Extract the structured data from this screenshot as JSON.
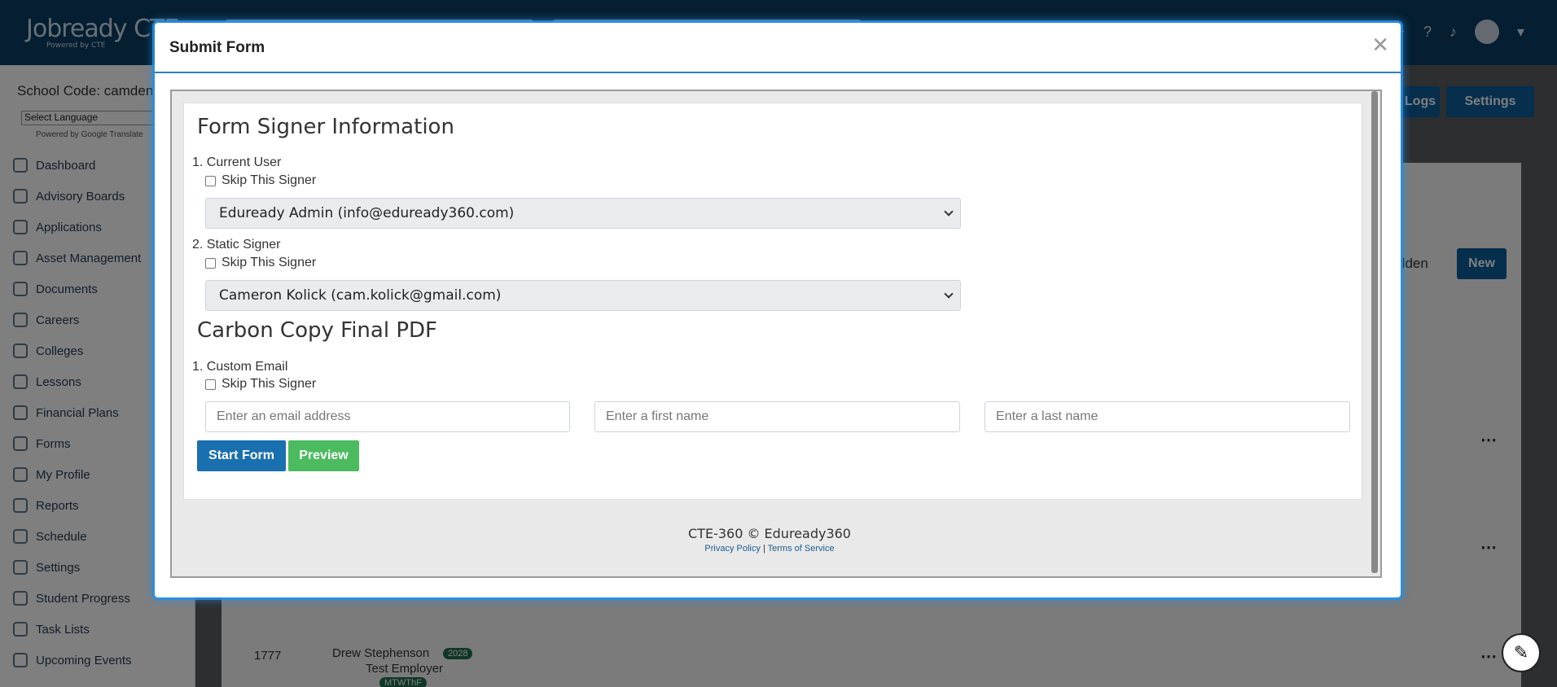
{
  "background": {
    "logo": "Jobready CTE",
    "logo_sub": "Powered by CTE",
    "school_code": "School Code: camden",
    "language_select": "Select Language",
    "powered_by": "Powered by Google Translate",
    "nav": [
      {
        "label": "Dashboard",
        "icon": "gauge-icon"
      },
      {
        "label": "Advisory Boards",
        "icon": "handshake-icon"
      },
      {
        "label": "Applications",
        "icon": "file-icon"
      },
      {
        "label": "Asset Management",
        "icon": "box-icon"
      },
      {
        "label": "Documents",
        "icon": "document-icon"
      },
      {
        "label": "Careers",
        "icon": "person-icon"
      },
      {
        "label": "Colleges",
        "icon": "graduation-cap-icon"
      },
      {
        "label": "Lessons",
        "icon": "board-icon"
      },
      {
        "label": "Financial Plans",
        "icon": "piggy-bank-icon"
      },
      {
        "label": "Forms",
        "icon": "form-icon"
      },
      {
        "label": "My Profile",
        "icon": "user-icon"
      },
      {
        "label": "Reports",
        "icon": "printer-icon"
      },
      {
        "label": "Schedule",
        "icon": "clock-icon"
      },
      {
        "label": "Settings",
        "icon": "gears-icon"
      },
      {
        "label": "Student Progress",
        "icon": "progress-icon"
      },
      {
        "label": "Task Lists",
        "icon": "list-icon"
      },
      {
        "label": "Upcoming Events",
        "icon": "calendar-icon"
      }
    ],
    "logs_button": "Logs",
    "settings_button": "Settings",
    "new_button": "New",
    "hidden_text": "dden",
    "row": {
      "id": "1777",
      "name": "Drew Stephenson",
      "year_badge": "2028",
      "employer": "Test Employer",
      "tag": "MTWThF"
    }
  },
  "modal": {
    "title": "Submit Form",
    "close_icon": "close-icon",
    "section_signer_heading": "Form Signer Information",
    "signers": [
      {
        "label": "1. Current User",
        "skip_label": "Skip This Signer",
        "selected": "Eduready Admin (info@eduready360.com)"
      },
      {
        "label": "2. Static Signer",
        "skip_label": "Skip This Signer",
        "selected": "Cameron Kolick (cam.kolick@gmail.com)"
      }
    ],
    "section_cc_heading": "Carbon Copy Final PDF",
    "cc": {
      "label": "1. Custom Email",
      "skip_label": "Skip This Signer",
      "email_placeholder": "Enter an email address",
      "first_name_placeholder": "Enter a first name",
      "last_name_placeholder": "Enter a last name"
    },
    "start_button": "Start Form",
    "preview_button": "Preview",
    "footer_copy": "CTE-360 © Eduready360",
    "privacy_link": "Privacy Policy",
    "link_separator": "|",
    "terms_link": "Terms of Service"
  },
  "colors": {
    "topbar": "#0a3d62",
    "primary": "#1a6fae",
    "success": "#4cbb5f",
    "modal_glow": "#268fe6"
  }
}
